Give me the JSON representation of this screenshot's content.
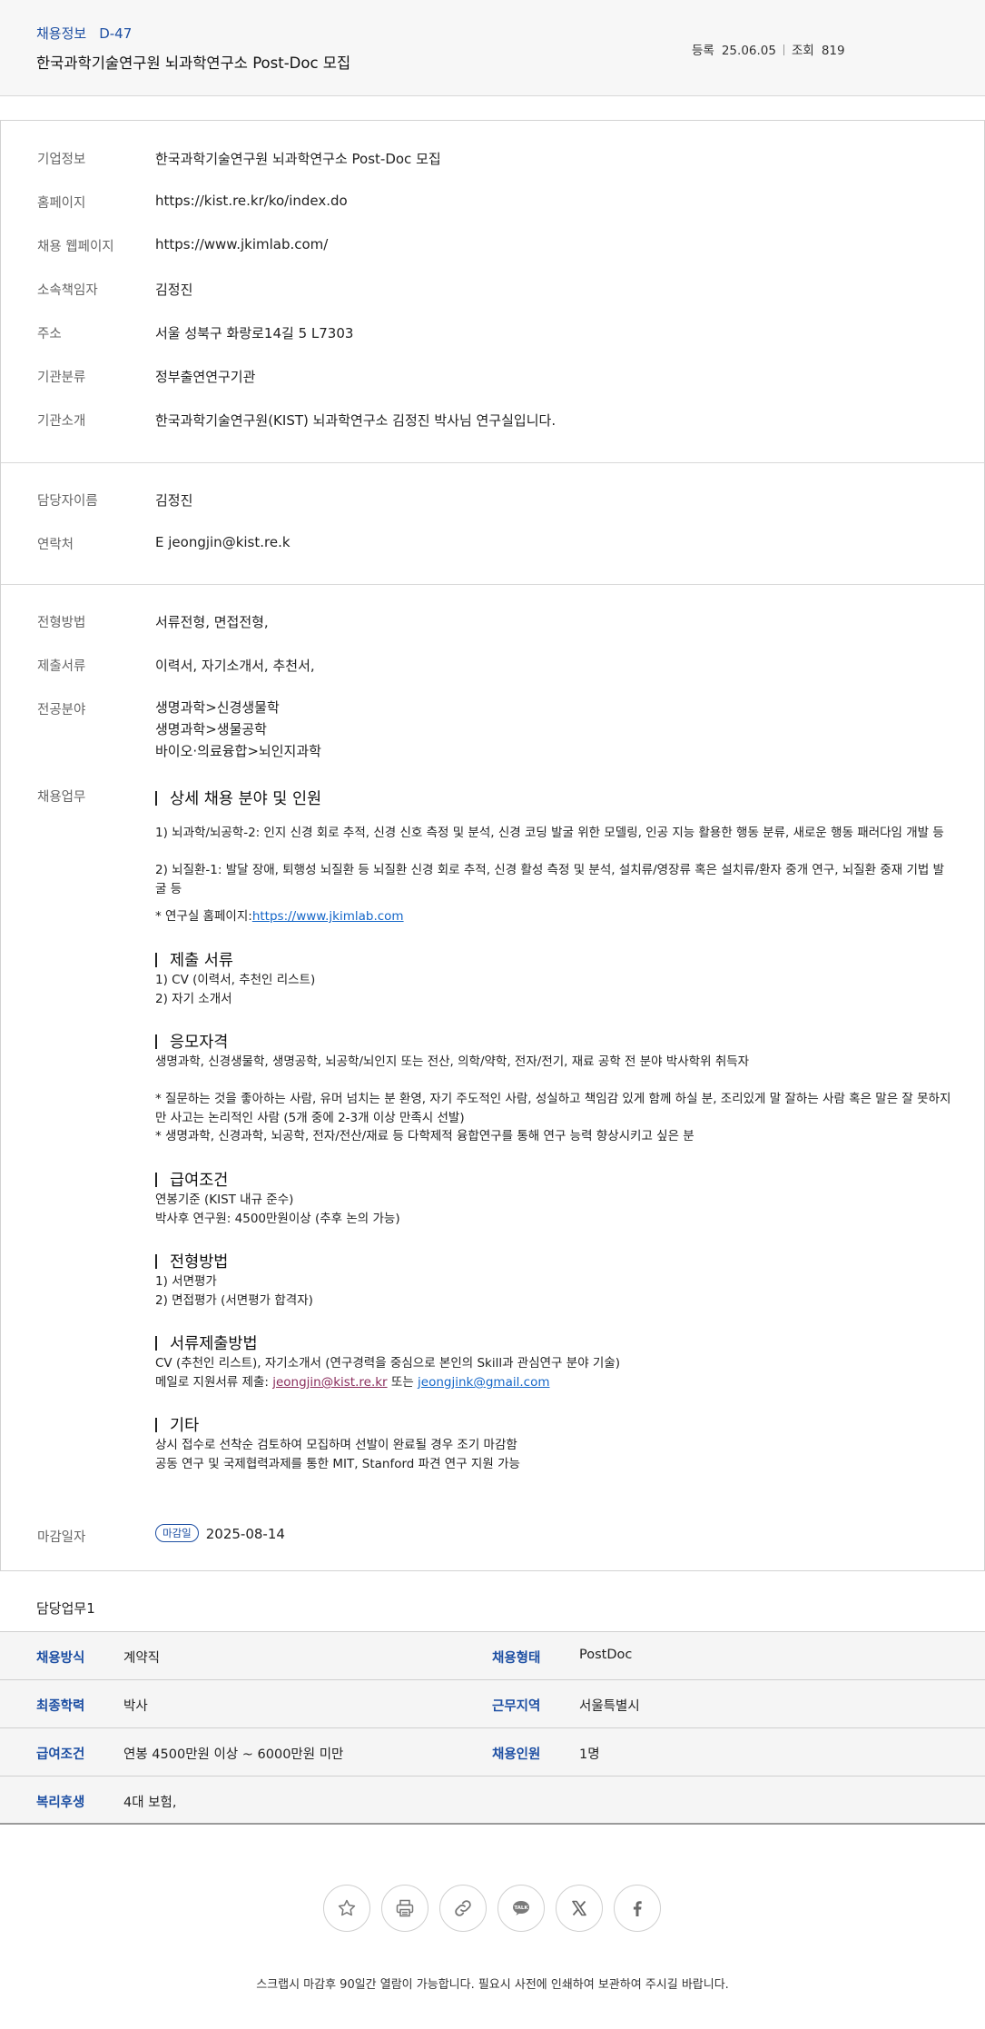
{
  "header": {
    "category": "채용정보",
    "code": "D-47",
    "title": "한국과학기술연구원 뇌과학연구소 Post-Doc 모집",
    "reg_label": "등록",
    "reg_date": "25.06.05",
    "view_label": "조회",
    "view_count": "819"
  },
  "company": [
    {
      "k": "기업정보",
      "v": "한국과학기술연구원 뇌과학연구소 Post-Doc 모집"
    },
    {
      "k": "홈페이지",
      "v": "https://kist.re.kr/ko/index.do"
    },
    {
      "k": "채용 웹페이지",
      "v": "https://www.jkimlab.com/"
    },
    {
      "k": "소속책임자",
      "v": "김정진"
    },
    {
      "k": "주소",
      "v": "서울 성북구 화랑로14길 5 L7303"
    },
    {
      "k": "기관분류",
      "v": "정부출연연구기관"
    },
    {
      "k": "기관소개",
      "v": "한국과학기술연구원(KIST) 뇌과학연구소 김정진 박사님 연구실입니다."
    }
  ],
  "contact": [
    {
      "k": "담당자이름",
      "v": "김정진"
    },
    {
      "k": "연락처",
      "v": "E  jeongjin@kist.re.k"
    }
  ],
  "recruit": {
    "method_k": "전형방법",
    "method_v": "서류전형, 면접전형,",
    "docs_k": "제출서류",
    "docs_v": "이력서, 자기소개서, 추천서,",
    "field_k": "전공분야",
    "field_v": [
      "생명과학>신경생물학",
      "생명과학>생물공학",
      "바이오·의료융합>뇌인지과학"
    ],
    "duty_k": "채용업무",
    "deadline_k": "마감일자",
    "deadline_badge": "마감일",
    "deadline_v": "2025-08-14"
  },
  "detail": {
    "h1": "상세 채용 분야 및 인원",
    "p1a": "1)     뇌과학/뇌공학-2: 인지 신경 회로 추적, 신경 신호 측정 및 분석, 신경 코딩 발굴 위한 모델링, 인공 지능 활용한 행동 분류, 새로운 행동 패러다임 개발 등",
    "p1b": "2)     뇌질환-1: 발달 장애, 퇴행성 뇌질환 등 뇌질환 신경 회로 추적, 신경 활성 측정 및 분석, 설치류/영장류 혹은 설치류/환자 중개 연구, 뇌질환 중재 기법 발굴 등",
    "p1c_prefix": " * 연구실 홈페이지:",
    "p1c_link": "https://www.jkimlab.com",
    "h2": "제출 서류",
    "p2a": "1)     CV (이력서,  추천인 리스트)",
    "p2b": "2)     자기 소개서",
    "h3": "응모자격",
    "p3a": "생명과학, 신경생물학, 생명공학, 뇌공학/뇌인지 또는 전산, 의학/약학, 전자/전기, 재료 공학 전 분야 박사학위 취득자",
    "p3b": "* 질문하는 것을 좋아하는 사람, 유머 넘치는 분 환영, 자기 주도적인 사람, 성실하고 책임감 있게 함께 하실 분, 조리있게 말 잘하는 사람 혹은 말은 잘 못하지만 사고는 논리적인 사람 (5개 중에 2-3개 이상 만족시 선발)",
    "p3c": "* 생명과학, 신경과학, 뇌공학, 전자/전산/재료 등 다학제적 융합연구를 통해 연구 능력 향상시키고 싶은 분",
    "h4": "급여조건",
    "p4a": "연봉기준 (KIST 내규 준수)",
    "p4b": "박사후 연구원: 4500만원이상 (추후 논의 가능)",
    "h5": "전형방법",
    "p5a": "1) 서면평가",
    "p5b": "2) 면접평가 (서면평가 합격자)",
    "h6": "서류제출방법",
    "p6a": "CV (추천인 리스트), 자기소개서 (연구경력을 중심으로 본인의 Skill과 관심연구 분야 기술)",
    "p6b_prefix": "메일로 지원서류 제출: ",
    "p6b_link1": "jeongjin@kist.re.kr",
    "p6b_mid": " 또는 ",
    "p6b_link2": "jeongjink@gmail.com",
    "h7": "기타",
    "p7a": "상시 접수로 선착순 검토하여 모집하며 선발이 완료될 경우 조기 마감함",
    "p7b": "공동 연구 및 국제협력과제를 통한 MIT, Stanford 파견 연구 지원 가능"
  },
  "job": {
    "title": "담당업무1",
    "rows": [
      {
        "k1": "채용방식",
        "v1": "계약직",
        "k2": "채용형태",
        "v2": "PostDoc"
      },
      {
        "k1": "최종학력",
        "v1": "박사",
        "k2": "근무지역",
        "v2": "서울특별시"
      },
      {
        "k1": "급여조건",
        "v1": "연봉 4500만원 이상 ~ 6000만원 미만",
        "k2": "채용인원",
        "v2": "1명"
      },
      {
        "k1": "복리후생",
        "v1": "4대 보험,",
        "k2": "",
        "v2": ""
      }
    ]
  },
  "share": {
    "icons": [
      "star-icon",
      "print-icon",
      "link-icon",
      "kakaotalk-icon",
      "x-icon",
      "facebook-icon"
    ],
    "kakao_label": "TALK"
  },
  "footer": {
    "notice": "스크랩시 마감후 90일간 열람이 가능합니다. 필요시 사전에 인쇄하여 보관하여 주시길 바랍니다."
  }
}
